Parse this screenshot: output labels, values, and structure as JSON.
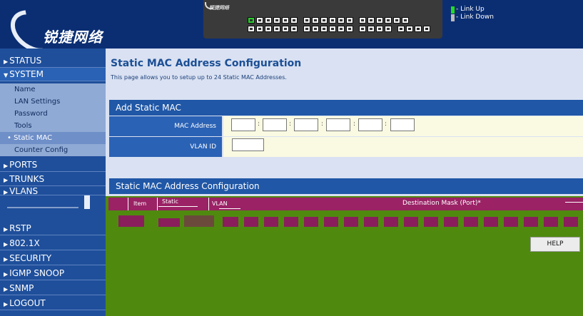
{
  "header": {
    "logo_text": "锐捷网络",
    "switch_brand": "锐捷网络",
    "legend": [
      {
        "label": "- Link Up",
        "color": "#22dd22"
      },
      {
        "label": "- Link Down",
        "color": "#bbbbbb"
      }
    ]
  },
  "sidebar": {
    "menus": {
      "status": "STATUS",
      "system": "SYSTEM",
      "ports": "PORTS",
      "trunks": "TRUNKS",
      "vlans": "VLANS",
      "rstp": "RSTP",
      "dot1x": "802.1X",
      "security": "SECURITY",
      "igmp": "IGMP SNOOP",
      "snmp": "SNMP",
      "logout": "LOGOUT"
    },
    "system_items": {
      "name": "Name",
      "lan": "LAN Settings",
      "password": "Password",
      "tools": "Tools",
      "static_mac": "Static MAC",
      "counter": "Counter Config"
    }
  },
  "main": {
    "title": "Static MAC Address Configuration",
    "description": "This page allows you to setup up to 24 Static MAC Addresses.",
    "add_section": "Add Static MAC",
    "mac_label": "MAC Address",
    "vlan_label": "VLAN ID",
    "config_section": "Static MAC Address Configuration",
    "table_headers": {
      "item": "Item",
      "static": "Static",
      "vlan": "VLAN",
      "dest": "Destination Mask (Port)*"
    },
    "help": "HELP"
  },
  "colors": {
    "header_bg": "#0b2e73",
    "sidebar_bg": "#1f4f9b",
    "section_bg": "#2057a6",
    "table_header_bg": "#9a2265",
    "page_bg": "#4f8a0f"
  }
}
